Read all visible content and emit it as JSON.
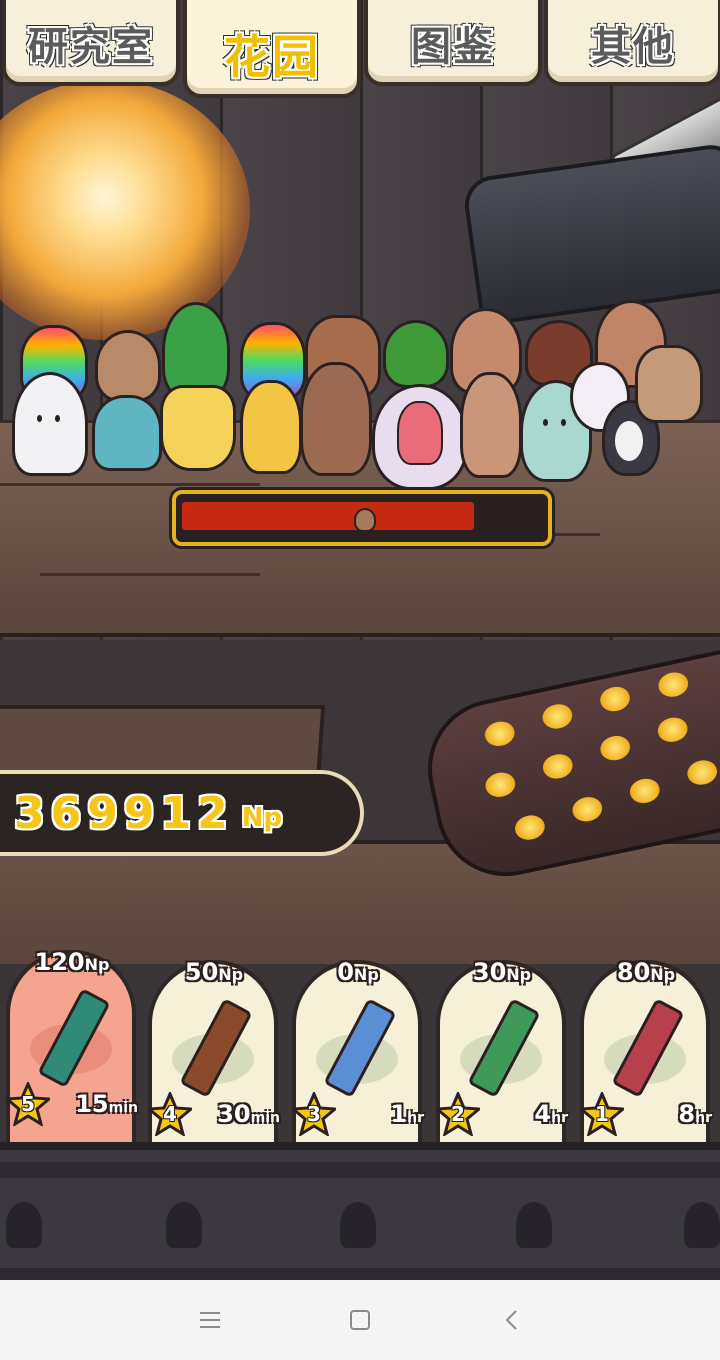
{
  "tabs": [
    {
      "label": "研究室",
      "active": false
    },
    {
      "label": "花园",
      "active": true
    },
    {
      "label": "图鉴",
      "active": false
    },
    {
      "label": "其他",
      "active": false
    }
  ],
  "growth_progress": 0.83,
  "currency": {
    "value": "369912",
    "unit": "Np"
  },
  "fertilizers": [
    {
      "price": "120",
      "price_unit": "Np",
      "stars": "5",
      "time": "15",
      "time_unit": "min",
      "color": "#2f8a78",
      "selected": true
    },
    {
      "price": "50",
      "price_unit": "Np",
      "stars": "4",
      "time": "30",
      "time_unit": "min",
      "color": "#8b4a2b",
      "selected": false
    },
    {
      "price": "0",
      "price_unit": "Np",
      "stars": "3",
      "time": "1",
      "time_unit": "hr",
      "color": "#5a8fd4",
      "selected": false
    },
    {
      "price": "30",
      "price_unit": "Np",
      "stars": "2",
      "time": "4",
      "time_unit": "hr",
      "color": "#3f9a5a",
      "selected": false
    },
    {
      "price": "80",
      "price_unit": "Np",
      "stars": "1",
      "time": "8",
      "time_unit": "hr",
      "color": "#b8404c",
      "selected": false
    }
  ],
  "colors": {
    "accent": "#f0c000",
    "progress_fill": "#c42a12",
    "selected_card": "#f4a48f"
  },
  "nav": {
    "menu_icon": "menu-icon",
    "home_icon": "home-square-icon",
    "back_icon": "back-chevron-icon"
  }
}
